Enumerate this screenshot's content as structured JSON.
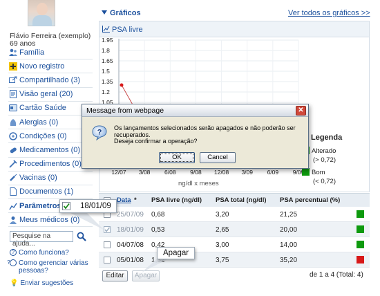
{
  "user": {
    "name": "Flávio Ferreira (exemplo)",
    "age": "69 anos"
  },
  "sidebar": {
    "items": [
      {
        "label": "Família",
        "icon": "family-icon"
      },
      {
        "label": "Novo registro",
        "icon": "plus-icon"
      },
      {
        "label": "Compartilhado (3)",
        "icon": "share-icon"
      },
      {
        "label": "Visão geral (20)",
        "icon": "overview-icon"
      },
      {
        "label": "Cartão Saúde",
        "icon": "card-icon"
      },
      {
        "label": "Alergias (0)",
        "icon": "allergy-icon"
      },
      {
        "label": "Condições (0)",
        "icon": "condition-icon"
      },
      {
        "label": "Medicamentos (0)",
        "icon": "pill-icon"
      },
      {
        "label": "Procedimentos (0)",
        "icon": "procedure-icon"
      },
      {
        "label": "Vacinas (0)",
        "icon": "vaccine-icon"
      },
      {
        "label": "Documentos (1)",
        "icon": "document-icon"
      },
      {
        "label": "Parâmetros",
        "icon": "parameters-icon"
      },
      {
        "label": "Meus médicos (0)",
        "icon": "doctor-icon"
      }
    ],
    "search_placeholder": "Pesquise na ajuda...",
    "help_links": [
      "Como funciona?",
      "Como gerenciar várias pessoas?"
    ],
    "suggest": "Enviar sugestões"
  },
  "main": {
    "section_title": "Gráficos",
    "see_all": "Ver todos os gráficos >>",
    "chart_title": "PSA livre",
    "legend_title": "Legenda",
    "legend": [
      {
        "label": "Alterado",
        "range": "(> 0,72)",
        "color": "#0e9a0e"
      },
      {
        "label": "Bom",
        "range": "(< 0,72)",
        "color": "#0e9a0e"
      }
    ]
  },
  "chart_data": {
    "type": "line",
    "title": "PSA livre",
    "xlabel": "ng/dl x meses",
    "ylabel": "",
    "yticks": [
      "1.95",
      "1.8",
      "1.65",
      "1.5",
      "1.35",
      "1.2",
      "1.05"
    ],
    "xticks": [
      "12/07",
      "3/08",
      "6/08",
      "9/08",
      "12/08",
      "3/09",
      "6/09",
      "9/09"
    ],
    "ylim": [
      1.0,
      1.95
    ],
    "points": [
      {
        "x": "12/07",
        "y": 1.3
      }
    ],
    "grid": true
  },
  "table": {
    "headers": [
      "Data",
      "*",
      "PSA livre (ng/dl)",
      "PSA total (ng/dl)",
      "PSA percentual (%)"
    ],
    "rows": [
      {
        "date": "25/07/09",
        "free": "0,68",
        "total": "3,20",
        "pct": "21,25",
        "status_color": "#0e9a0e",
        "checked": false
      },
      {
        "date": "18/01/09",
        "free": "0,53",
        "total": "2,65",
        "pct": "20,00",
        "status_color": "#0e9a0e",
        "checked": true
      },
      {
        "date": "04/07/08",
        "free": "0,42",
        "total": "3,00",
        "pct": "14,00",
        "status_color": "#0e9a0e",
        "checked": false
      },
      {
        "date": "05/01/08",
        "free": "1,32",
        "total": "3,75",
        "pct": "35,20",
        "status_color": "#d81818",
        "checked": false
      }
    ],
    "edit_label": "Editar",
    "delete_label": "Apagar",
    "pager": "de 1 a 4 (Total: 4)"
  },
  "callouts": {
    "date": "18/01/09",
    "delete": "Apagar"
  },
  "dialog": {
    "title": "Message from webpage",
    "message": "Os lançamentos selecionados serão apagados e não poderão ser recuperados.",
    "question": "Deseja confirmar a operação?",
    "ok": "OK",
    "cancel": "Cancel"
  }
}
